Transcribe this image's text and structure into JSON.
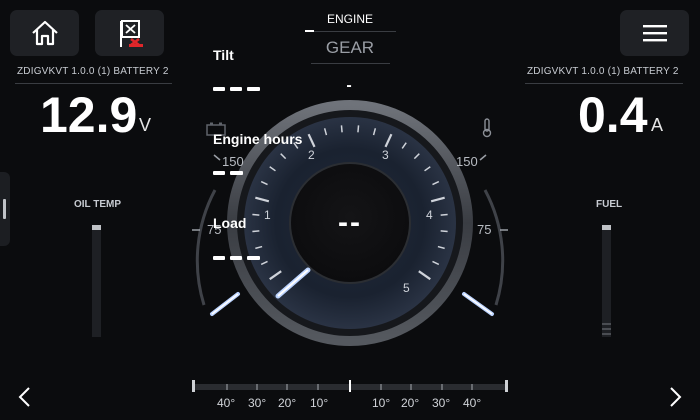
{
  "header": {
    "engine_title": "ENGINE",
    "gear_label": "GEAR",
    "gear_value": "-"
  },
  "left_panel": {
    "source_label": "ZDIGVKVT 1.0.0 (1) BATTERY 2",
    "value": "12.9",
    "unit": "V"
  },
  "right_panel": {
    "source_label": "ZDIGVKVT 1.0.0 (1) BATTERY 2",
    "value": "0.4",
    "unit": "A"
  },
  "overlay": {
    "tilt": {
      "label": "Tilt",
      "value": "---"
    },
    "engine_hours": {
      "label": "Engine hours",
      "value": "--"
    },
    "load": {
      "label": "Load",
      "value": "---"
    }
  },
  "gauge": {
    "center_value": "--",
    "rpm_ticks": [
      "1",
      "2",
      "3",
      "4",
      "5"
    ],
    "left_arc_labels": [
      "150",
      "75"
    ],
    "right_arc_labels": [
      "150",
      "75"
    ],
    "left_icon": "battery-icon",
    "right_icon": "thermometer-icon"
  },
  "bars": {
    "oil_temp_label": "OIL TEMP",
    "fuel_label": "FUEL"
  },
  "trim_scale": {
    "labels_left": [
      "40°",
      "30°",
      "20°",
      "10°"
    ],
    "labels_right": [
      "10°",
      "20°",
      "30°",
      "40°"
    ]
  },
  "icons": {
    "home": "home-icon",
    "alarm": "alarm-flag-icon",
    "menu": "menu-icon",
    "prev": "chevron-left-icon",
    "next": "chevron-right-icon"
  },
  "colors": {
    "background": "#0b0c0e",
    "button": "#1f2125",
    "needle_glow": "#bcd4ff",
    "alarm": "#e0262a"
  }
}
